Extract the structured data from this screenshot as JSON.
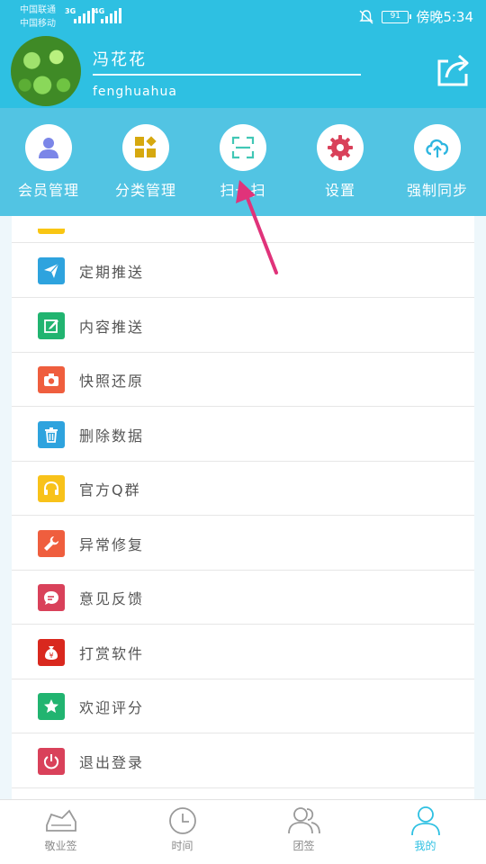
{
  "status_bar": {
    "carrier_1": "中国联通",
    "carrier_2": "中国移动",
    "net_1": "3G",
    "net_2": "4G",
    "battery": "91",
    "time": "傍晚5:34"
  },
  "profile": {
    "name": "冯花花",
    "account": "fenghuahua"
  },
  "actions": [
    {
      "label": "会员管理",
      "icon": "member-icon",
      "color": "#7b86e8"
    },
    {
      "label": "分类管理",
      "icon": "category-icon",
      "color": "#d6a80f"
    },
    {
      "label": "扫一扫",
      "icon": "scan-icon",
      "color": "#41c7b5"
    },
    {
      "label": "设置",
      "icon": "gear-icon",
      "color": "#d9415a"
    },
    {
      "label": "强制同步",
      "icon": "sync-icon",
      "color": "#2eb6e0"
    }
  ],
  "menu": [
    {
      "label": "定期推送",
      "icon": "send-icon",
      "color": "#2ea3de"
    },
    {
      "label": "内容推送",
      "icon": "edit-icon",
      "color": "#21b470"
    },
    {
      "label": "快照还原",
      "icon": "camera-icon",
      "color": "#ef5e3e"
    },
    {
      "label": "删除数据",
      "icon": "trash-icon",
      "color": "#2ea3de"
    },
    {
      "label": "官方Q群",
      "icon": "headset-icon",
      "color": "#f8c21a"
    },
    {
      "label": "异常修复",
      "icon": "wrench-icon",
      "color": "#ef5e3e"
    },
    {
      "label": "意见反馈",
      "icon": "feedback-icon",
      "color": "#d9415a"
    },
    {
      "label": "打赏软件",
      "icon": "money-bag-icon",
      "color": "#d9281e"
    },
    {
      "label": "欢迎评分",
      "icon": "star-icon",
      "color": "#21b470"
    },
    {
      "label": "退出登录",
      "icon": "power-icon",
      "color": "#d9415a"
    }
  ],
  "bottom_nav": [
    {
      "label": "敬业签",
      "icon": "note-icon",
      "active": false
    },
    {
      "label": "时间",
      "icon": "clock-icon",
      "active": false
    },
    {
      "label": "团签",
      "icon": "group-icon",
      "active": false
    },
    {
      "label": "我的",
      "icon": "person-icon",
      "active": true
    }
  ],
  "accent_color": "#2ec0e2",
  "annotation_color": "#e0337a"
}
